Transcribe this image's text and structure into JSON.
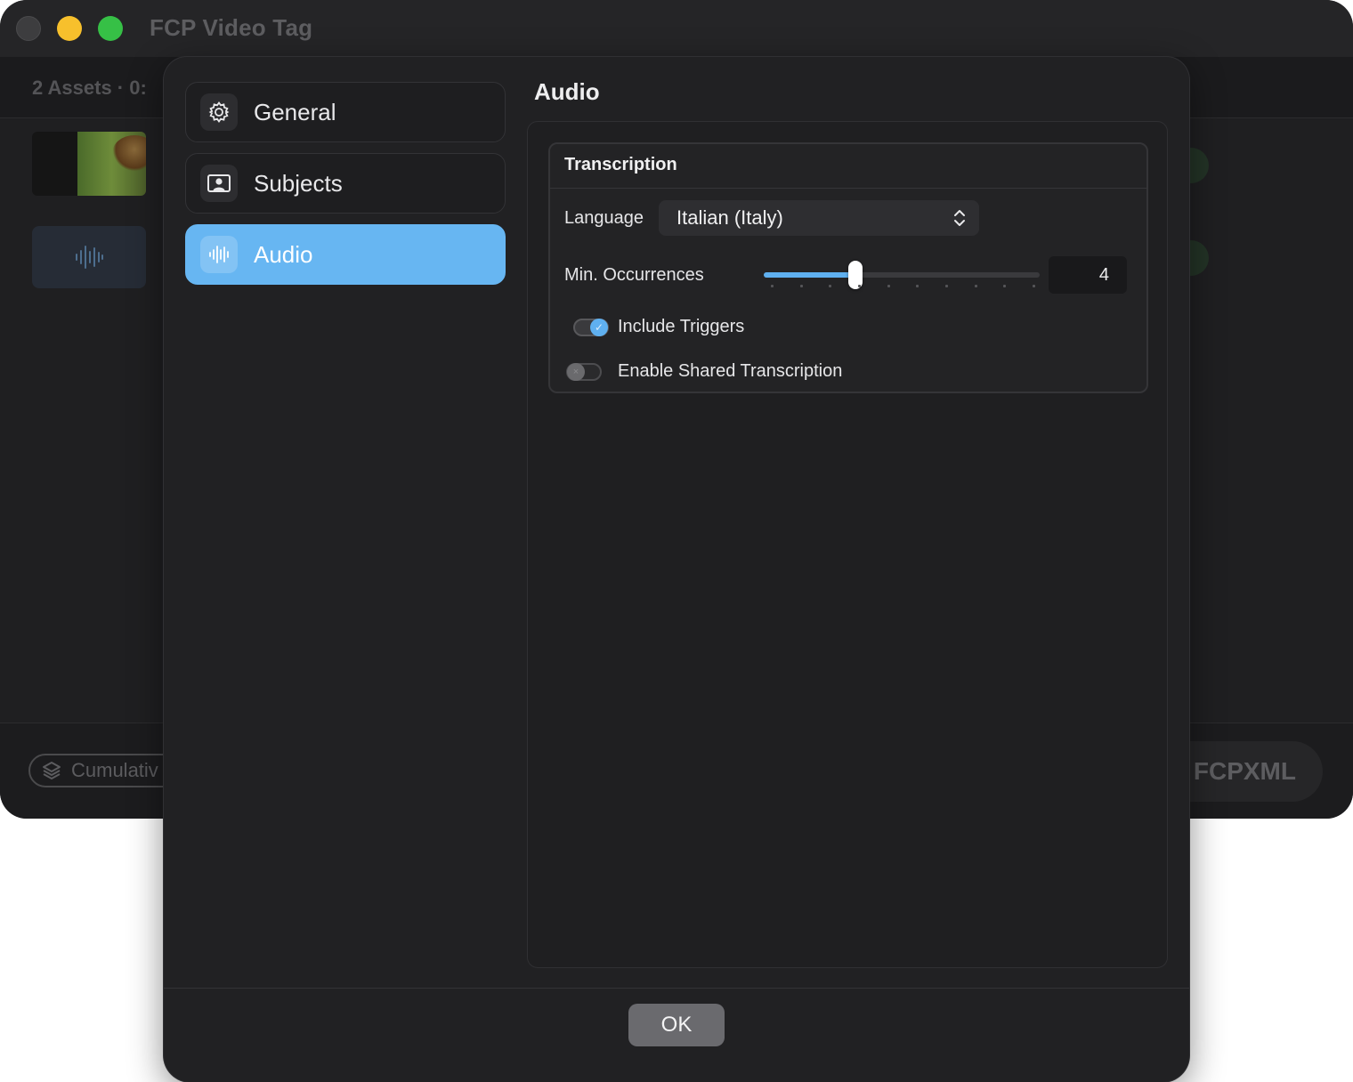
{
  "window": {
    "title": "FCP Video Tag",
    "assets_info": "2 Assets · 0:",
    "cumulative_label": "Cumulativ",
    "export_label": "t FCPXML",
    "traffic_colors": {
      "close": "#3d3d3f",
      "minimize": "#f7c02c",
      "maximize": "#36c046"
    }
  },
  "sidebar": {
    "items": [
      {
        "label": "General",
        "icon": "gear-icon",
        "active": false
      },
      {
        "label": "Subjects",
        "icon": "person-frame-icon",
        "active": false
      },
      {
        "label": "Audio",
        "icon": "waveform-icon",
        "active": true
      }
    ],
    "accent": "#67b6f2"
  },
  "content": {
    "section_title": "Audio",
    "group": {
      "title": "Transcription",
      "language_label": "Language",
      "language_value": "Italian (Italy)",
      "min_occ_label": "Min. Occurrences",
      "min_occ_value": "4",
      "slider": {
        "min": 1,
        "max": 10,
        "value": 4
      },
      "include_triggers_label": "Include Triggers",
      "include_triggers": true,
      "shared_transcription_label": "Enable Shared Transcription",
      "shared_transcription": false
    }
  },
  "footer": {
    "ok_label": "OK"
  }
}
